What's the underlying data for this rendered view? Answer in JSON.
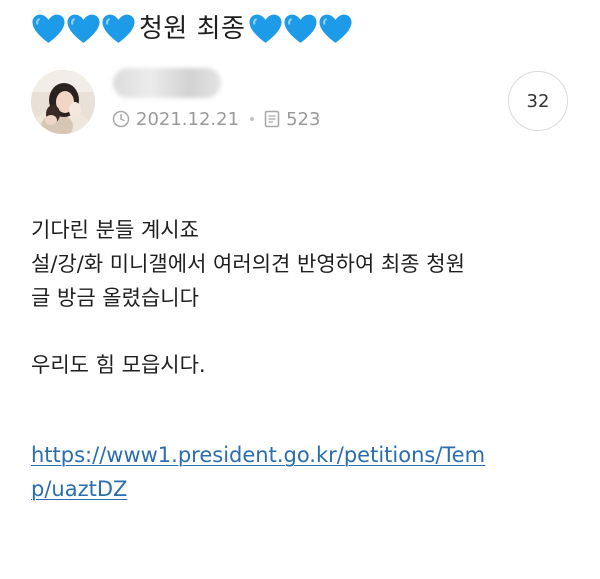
{
  "post": {
    "title": "청원 최종",
    "hearts_left_count": 3,
    "hearts_right_count": 3,
    "heart_color": "#1e9be8",
    "date": "2021.12.21",
    "views": "523",
    "comment_count": "32",
    "author_name_blurred": true
  },
  "body": {
    "line1": "기다린 분들 계시죠",
    "line2": "설/강/화 미니갤에서 여러의견 반영하여 최종 청원",
    "line3": "글 방금 올렸습니다",
    "line4": "우리도 힘 모읍시다.",
    "link_part1": "https://www1.president.go.kr/petitions/Tem",
    "link_part2": "p/uaztDZ",
    "link_color": "#2a6db0"
  },
  "icons": {
    "heart": "blue-heart-icon",
    "date": "clock-icon",
    "views": "document-icon"
  }
}
